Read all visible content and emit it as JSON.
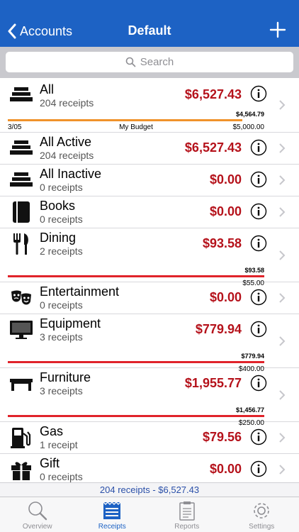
{
  "nav": {
    "back_label": "Accounts",
    "title": "Default"
  },
  "search": {
    "placeholder": "Search"
  },
  "rows": [
    {
      "name": "All",
      "count": "204 receipts",
      "amount": "$6,527.43",
      "budget": {
        "spent": "$4,564.79",
        "limit": "$5,000.00",
        "date": "3/05",
        "label": "My Budget",
        "fill": 0.913,
        "color": "#f0922b"
      }
    },
    {
      "name": "All Active",
      "count": "204 receipts",
      "amount": "$6,527.43"
    },
    {
      "name": "All Inactive",
      "count": "0 receipts",
      "amount": "$0.00"
    },
    {
      "name": "Books",
      "count": "0 receipts",
      "amount": "$0.00"
    },
    {
      "name": "Dining",
      "count": "2 receipts",
      "amount": "$93.58",
      "budget": {
        "spent": "$93.58",
        "limit": "$55.00",
        "fill": 1.0,
        "color": "#e0232a"
      }
    },
    {
      "name": "Entertainment",
      "count": "0 receipts",
      "amount": "$0.00"
    },
    {
      "name": "Equipment",
      "count": "3 receipts",
      "amount": "$779.94",
      "budget": {
        "spent": "$779.94",
        "limit": "$400.00",
        "fill": 1.0,
        "color": "#e0232a"
      }
    },
    {
      "name": "Furniture",
      "count": "3 receipts",
      "amount": "$1,955.77",
      "budget": {
        "spent": "$1,456.77",
        "limit": "$250.00",
        "fill": 1.0,
        "color": "#e0232a"
      }
    },
    {
      "name": "Gas",
      "count": "1 receipt",
      "amount": "$79.56"
    },
    {
      "name": "Gift",
      "count": "0 receipts",
      "amount": "$0.00"
    }
  ],
  "summary": "204 receipts - $6,527.43",
  "tabs": [
    {
      "label": "Overview",
      "icon": "magnifier-icon",
      "active": false
    },
    {
      "label": "Receipts",
      "icon": "receipts-icon",
      "active": true
    },
    {
      "label": "Reports",
      "icon": "clipboard-icon",
      "active": false
    },
    {
      "label": "Settings",
      "icon": "gear-icon",
      "active": false
    }
  ],
  "colors": {
    "nav": "#1d62c4",
    "amount": "#b5121b",
    "budget_ok": "#f0922b",
    "budget_over": "#e0232a"
  }
}
